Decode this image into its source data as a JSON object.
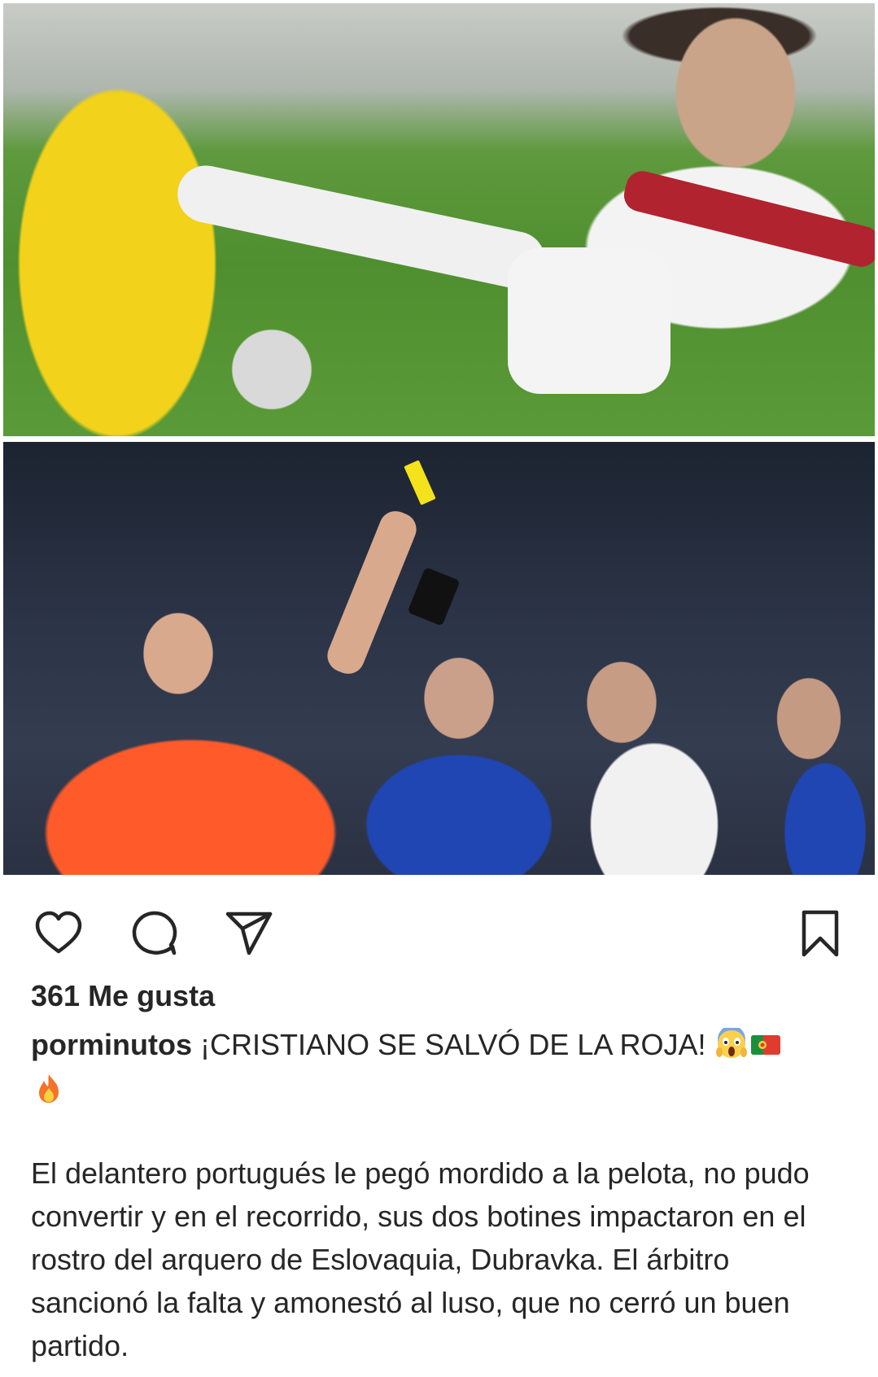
{
  "post": {
    "images": [
      {
        "name": "photo-tackle"
      },
      {
        "name": "photo-yellow-card"
      }
    ],
    "actions": {
      "like_icon": "heart-icon",
      "comment_icon": "comment-icon",
      "share_icon": "paper-plane-icon",
      "save_icon": "bookmark-icon"
    },
    "likes_text": "361 Me gusta",
    "author": "porminutos",
    "headline": " ¡CRISTIANO SE SALVÓ DE LA ROJA! ",
    "headline_emojis": [
      "screaming-face-emoji",
      "portugal-flag-emoji",
      "fire-emoji"
    ],
    "body": "El delantero portugués le pegó mordido a la pelota, no pudo convertir y en el recorrido, sus dos botines impactaron en el rostro del arquero de Eslovaquia, Dubravka. El árbitro sancionó la falta y amonestó al luso, que no cerró un buen partido."
  },
  "colors": {
    "text": "#262626",
    "background": "#ffffff",
    "icon_stroke": "#262626"
  }
}
